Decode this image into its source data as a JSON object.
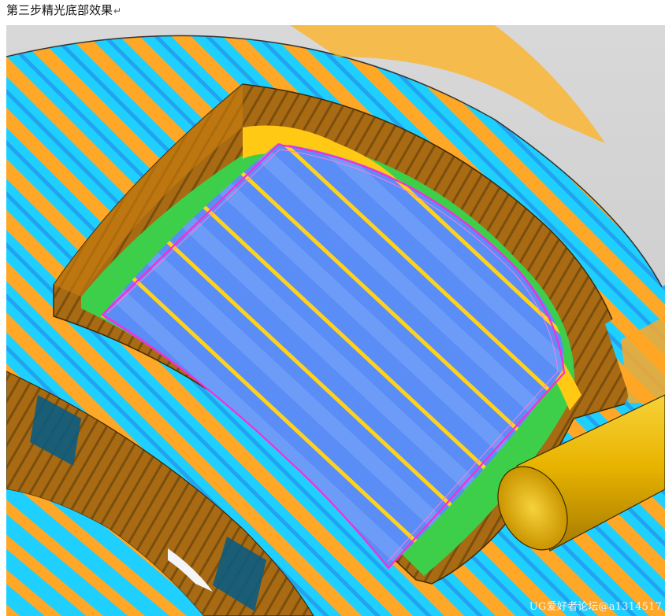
{
  "caption": {
    "text": "第三步精光底部效果",
    "return_mark": "↵"
  },
  "render": {
    "analysis_palette": {
      "cyan": "#1fd0ff",
      "orange": "#ffa726",
      "yellow": "#ffcf1a",
      "brown_wall": "#a86a12",
      "dark_brown": "#6e4a0c",
      "green": "#3ecf4a",
      "floor_blue": "#5a8df5",
      "toolpath_magenta": "#ff2ad4",
      "tool_gold": "#e9b400",
      "background_gray": "#cdcdcd"
    },
    "icons": [
      "tool-shank-icon"
    ]
  },
  "watermark": {
    "text": "UG爱好者论坛@a1314517"
  }
}
